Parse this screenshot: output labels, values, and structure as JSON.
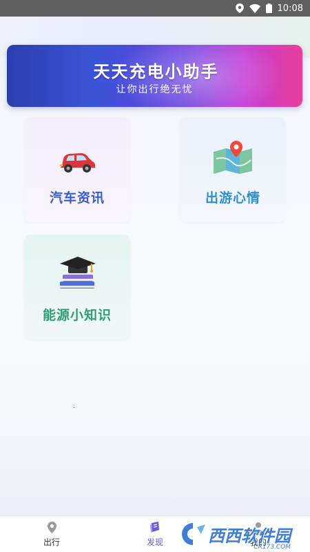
{
  "status_bar": {
    "time": "10:08"
  },
  "banner": {
    "title": "天天充电小助手",
    "subtitle": "让你出行绝无忧",
    "colors": {
      "start": "#2c3fae",
      "mid": "#6b3fe0",
      "end": "#ea3f9a"
    }
  },
  "cards": [
    {
      "label": "汽车资讯",
      "icon": "car-icon",
      "color": "#3a5bd6"
    },
    {
      "label": "出游心情",
      "icon": "map-pin-icon",
      "color": "#2f8fd6"
    },
    {
      "label": "能源小知识",
      "icon": "graduation-books-icon",
      "color": "#2f9e77"
    }
  ],
  "tabbar": {
    "tabs": [
      {
        "label": "出行",
        "icon": "location-pin-icon",
        "active": false
      },
      {
        "label": "发现",
        "icon": "discover-icon",
        "active": true
      },
      {
        "label": "我的",
        "icon": "profile-icon",
        "active": false
      }
    ],
    "accent": "#6a5ae0"
  },
  "watermark": {
    "text": "西西软件园",
    "url": "CR173.COM"
  }
}
